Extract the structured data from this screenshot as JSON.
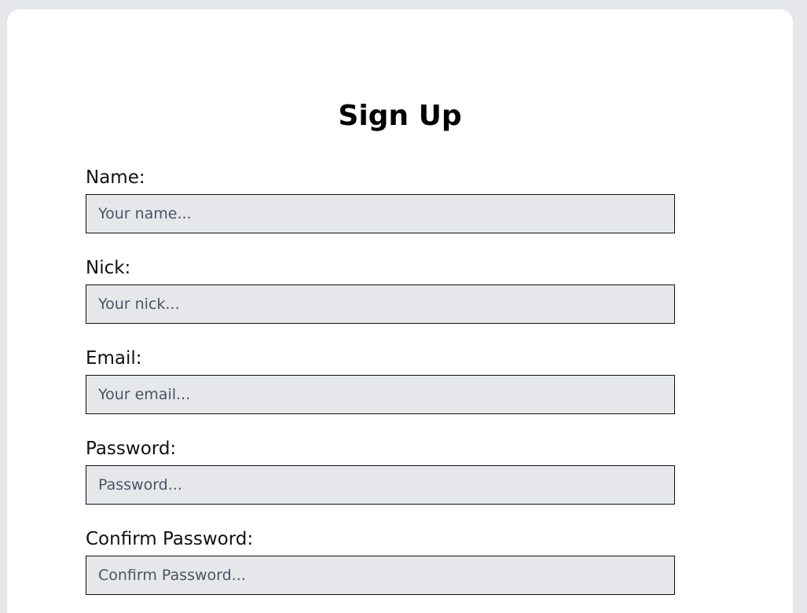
{
  "page": {
    "title": "Sign Up"
  },
  "form": {
    "fields": [
      {
        "label": "Name:",
        "placeholder": "Your name..."
      },
      {
        "label": "Nick:",
        "placeholder": "Your nick..."
      },
      {
        "label": "Email:",
        "placeholder": "Your email..."
      },
      {
        "label": "Password:",
        "placeholder": "Password..."
      },
      {
        "label": "Confirm Password:",
        "placeholder": "Confirm Password..."
      }
    ]
  },
  "colors": {
    "background": "#e5e7eb",
    "card": "#ffffff",
    "input_background": "#e5e7eb",
    "input_border": "#111111",
    "placeholder": "#4b5563"
  }
}
